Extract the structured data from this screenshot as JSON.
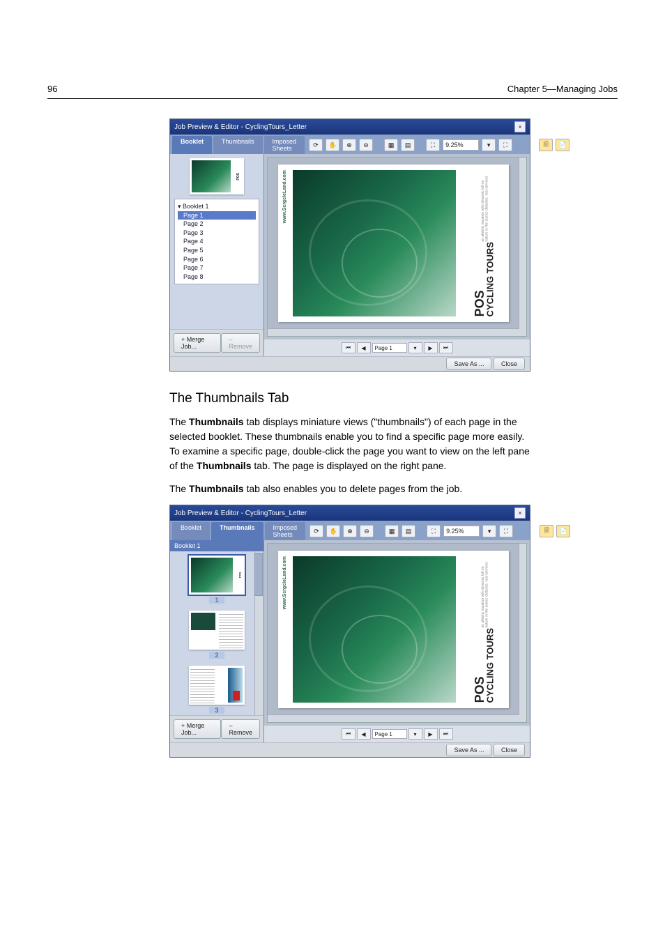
{
  "header": {
    "page_number": "96",
    "chapter": "Chapter 5—Managing Jobs"
  },
  "body": {
    "h2": "The Thumbnails Tab",
    "p1_a": "The ",
    "p1_b": "Thumbnails",
    "p1_c": " tab displays miniature views (\"thumbnails\") of each page in the selected booklet. These thumbnails enable you to find a specific page more easily. To examine a specific page, double-click the page you want to view on the left pane of the ",
    "p1_d": "Thumbnails",
    "p1_e": " tab. The page is displayed on the right pane.",
    "p2_a": "The ",
    "p2_b": "Thumbnails",
    "p2_c": " tab also enables you to delete pages from the job."
  },
  "screenshot": {
    "title": "Job Preview & Editor - CyclingTours_Letter",
    "close_glyph": "×",
    "tabs": {
      "booklet": "Booklet",
      "thumbnails": "Thumbnails",
      "imposed": "Imposed Sheets"
    },
    "booklet_tree": {
      "root": "Booklet 1",
      "pages": [
        "Page 1",
        "Page 2",
        "Page 3",
        "Page 4",
        "Page 5",
        "Page 6",
        "Page 7",
        "Page 8"
      ]
    },
    "thumb_header": "Booklet 1",
    "thumb_labels": [
      "1",
      "2",
      "3"
    ],
    "toolbar": {
      "zoom_value": "9.25%",
      "dropdown_glyph": "▾",
      "fit_glyph": "⛶",
      "refresh_glyph": "⟳",
      "hand_glyph": "✋",
      "zoomin_glyph": "⊕",
      "zoomout_glyph": "⊖",
      "grid1_glyph": "▦",
      "grid2_glyph": "▤",
      "doc1_glyph": "🗎",
      "doc2_glyph": "📄"
    },
    "preview_doc": {
      "logo_line1": "POS",
      "logo_line2": "CYCLING TOURS",
      "url": "www.ScrgcleLand.com",
      "tagline": "an athletic vacation with dynamic full-on nature in the scenic distance. real services"
    },
    "pager": {
      "first": "⏮",
      "prev": "◀",
      "label": "Page 1",
      "dropdown": "▾",
      "next": "▶",
      "last": "⏭"
    },
    "buttons": {
      "merge": "+ Merge Job...",
      "remove": "– Remove",
      "save_as": "Save As ...",
      "close": "Close"
    }
  }
}
